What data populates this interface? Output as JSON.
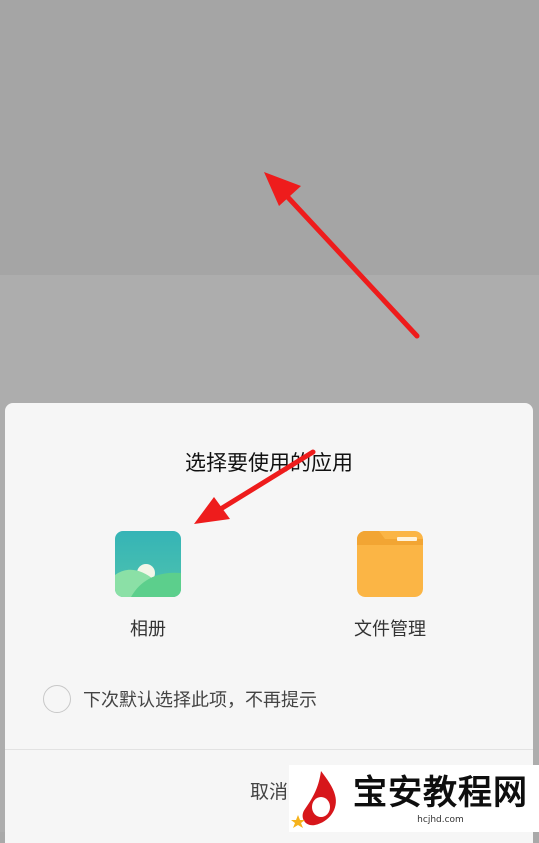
{
  "dialog": {
    "title": "选择要使用的应用",
    "apps": [
      {
        "label": "相册",
        "icon": "gallery-icon"
      },
      {
        "label": "文件管理",
        "icon": "folder-icon"
      }
    ],
    "default_option_label": "下次默认选择此项，不再提示",
    "default_option_checked": false,
    "cancel_label": "取消"
  },
  "watermark": {
    "title": "宝安教程网",
    "url": "hcjhd.com"
  },
  "annotations": {
    "arrow_color": "#ee1c1c"
  },
  "colors": {
    "gallery_teal": "#3cbcb4",
    "gallery_green": "#6ad89a",
    "folder_orange": "#fbb545"
  }
}
